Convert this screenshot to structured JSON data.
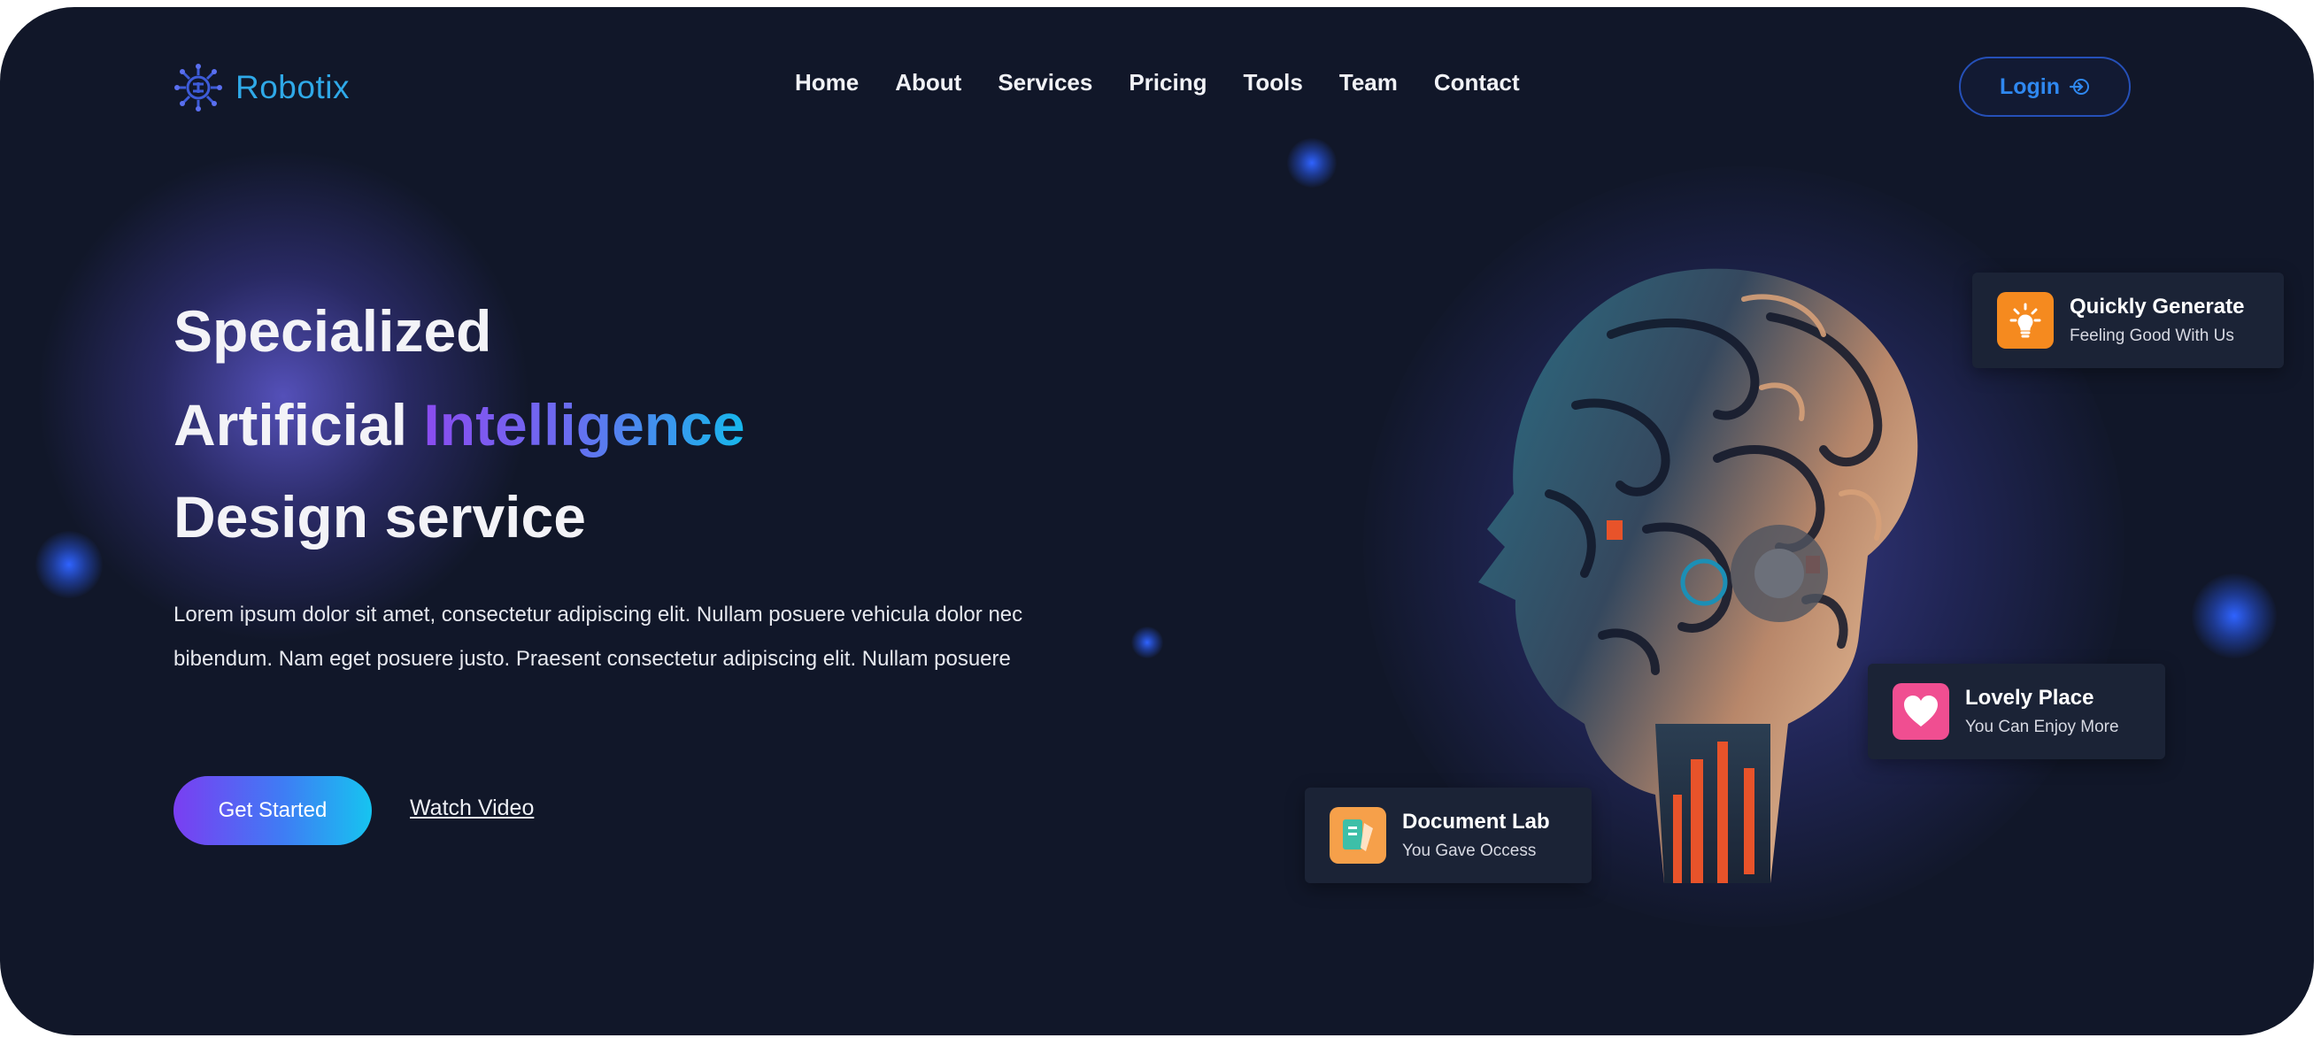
{
  "brand": {
    "name": "Robotix",
    "logo_icon": "robot-circuit-icon",
    "color": "#2fa9e8"
  },
  "nav": {
    "items": [
      {
        "label": "Home"
      },
      {
        "label": "About"
      },
      {
        "label": "Services"
      },
      {
        "label": "Pricing"
      },
      {
        "label": "Tools"
      },
      {
        "label": "Team"
      },
      {
        "label": "Contact"
      }
    ],
    "login_label": "Login",
    "login_icon": "login-arrow-icon"
  },
  "hero": {
    "line1": "Specialized",
    "line2_prefix": "Artificial",
    "line2_highlight": "Intelligence",
    "line3": "Design service",
    "description": "Lorem ipsum dolor sit amet, consectetur adipiscing elit. Nullam posuere vehicula dolor nec bibendum. Nam eget posuere justo. Praesent consectetur adipiscing elit. Nullam posuere",
    "primary_button": "Get Started",
    "secondary_link": "Watch Video"
  },
  "cards": [
    {
      "title": "Quickly Generate",
      "subtitle": "Feeling Good With Us",
      "icon": "lightbulb-icon",
      "color": "#f58a1f"
    },
    {
      "title": "Lovely Place",
      "subtitle": "You Can Enjoy More",
      "icon": "heart-icon",
      "color": "#f04e91"
    },
    {
      "title": "Document Lab",
      "subtitle": "You Gave Occess",
      "icon": "document-icon",
      "color": "#f6a04a"
    }
  ],
  "colors": {
    "background": "#111729",
    "accent_purple": "#7a3ef2",
    "accent_cyan": "#16c4f0",
    "login_border": "#2550b8"
  }
}
